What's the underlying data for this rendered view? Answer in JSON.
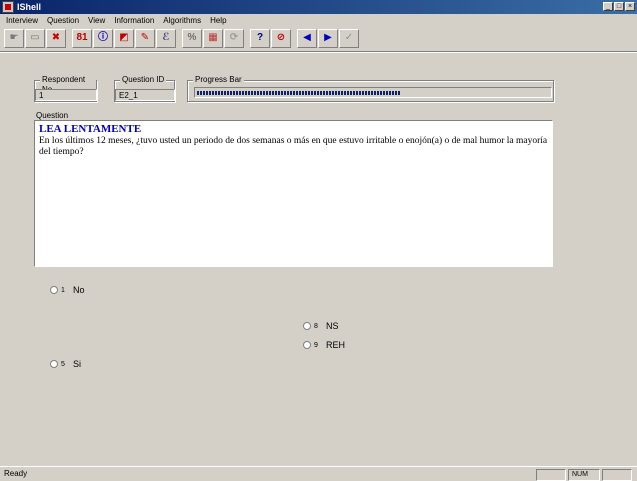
{
  "window": {
    "title": "IShell",
    "controls": [
      "_",
      "□",
      "×"
    ]
  },
  "menu": [
    "Interview",
    "Question",
    "View",
    "Information",
    "Algorithms",
    "Help"
  ],
  "toolbar": {
    "buttons": [
      {
        "name": "pointer-icon",
        "glyph": "☛",
        "color": "#7a7a7a"
      },
      {
        "name": "notepad-icon",
        "glyph": "▭",
        "color": "#7a7a7a"
      },
      {
        "name": "delete-x-icon",
        "glyph": "✖",
        "color": "#d00000"
      },
      {
        "name": "info-book-icon",
        "glyph": "81",
        "color": "#c00000"
      },
      {
        "name": "info-icon",
        "glyph": "ⓘ",
        "color": "#0000c0"
      },
      {
        "name": "red-flag-icon",
        "glyph": "◩",
        "color": "#c00000"
      },
      {
        "name": "edit-pencil-icon",
        "glyph": "✎",
        "color": "#c00000"
      },
      {
        "name": "check-mark-icon",
        "glyph": "ℰ",
        "color": "#404080"
      },
      {
        "name": "calculator-icon",
        "glyph": "%",
        "color": "#707070"
      },
      {
        "name": "chart-icon",
        "glyph": "▦",
        "color": "#c03030"
      },
      {
        "name": "refresh-icon",
        "glyph": "⟳",
        "color": "#9a9a9a"
      },
      {
        "name": "help-question-icon",
        "glyph": "?",
        "color": "#000080"
      },
      {
        "name": "stop-icon",
        "glyph": "⊘",
        "color": "#c00000"
      },
      {
        "name": "back-arrow-icon",
        "glyph": "◀",
        "color": "#0000c0"
      },
      {
        "name": "forward-arrow-icon",
        "glyph": "▶",
        "color": "#0000c0"
      },
      {
        "name": "checkmark-icon",
        "glyph": "✓",
        "color": "#909090"
      }
    ]
  },
  "respondent": {
    "label": "Respondent No",
    "value": "1"
  },
  "question_id": {
    "label": "Question ID",
    "value": "E2_1"
  },
  "progress": {
    "label": "Progress Bar",
    "fraction": 0.58
  },
  "question": {
    "label": "Question",
    "heading": "LEA LENTAMENTE",
    "text": "En los últimos 12 meses, ¿tuvo usted un periodo de dos semanas o más en que estuvo irritable o enojón(a) o de mal humor la mayoría del tiempo?"
  },
  "answers": [
    {
      "code": "1",
      "label": "No"
    },
    {
      "code": "8",
      "label": "NS"
    },
    {
      "code": "9",
      "label": "REH"
    },
    {
      "code": "5",
      "label": "Si"
    }
  ],
  "status": {
    "text": "Ready",
    "num": "NUM"
  },
  "colors": {
    "title_bar": "#0a246a",
    "heading": "#0000c0",
    "face": "#d4d0c8"
  }
}
